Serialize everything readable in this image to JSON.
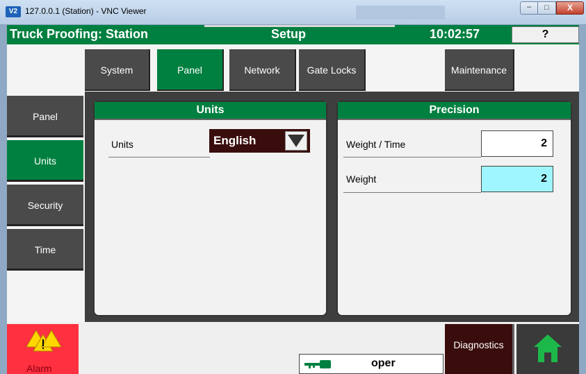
{
  "window": {
    "title": "127.0.0.1 (Station) - VNC Viewer",
    "icon_text": "V2",
    "controls": {
      "minimize": "–",
      "maximize": "□",
      "close": "X"
    }
  },
  "header": {
    "title": "Truck Proofing: Station",
    "screen": "Setup",
    "time": "10:02:57",
    "help_label": "?"
  },
  "top_tabs": [
    {
      "label": "System",
      "active": false
    },
    {
      "label": "Panel",
      "active": true
    },
    {
      "label": "Network",
      "active": false
    },
    {
      "label": "Gate Locks",
      "active": false
    },
    {
      "label": "Maintenance",
      "active": false
    }
  ],
  "side_tabs": [
    {
      "label": "Panel",
      "active": false
    },
    {
      "label": "Units",
      "active": true
    },
    {
      "label": "Security",
      "active": false
    },
    {
      "label": "Time",
      "active": false
    }
  ],
  "units_panel": {
    "title": "Units",
    "row_label": "Units",
    "selected_value": "English"
  },
  "precision_panel": {
    "title": "Precision",
    "rows": [
      {
        "label": "Weight / Time",
        "value": "2"
      },
      {
        "label": "Weight",
        "value": "2"
      }
    ]
  },
  "footer": {
    "alarm_label": "Alarm",
    "user": "oper",
    "diagnostics_label": "Diagnostics"
  },
  "colors": {
    "brand_green": "#008040",
    "dark_tab": "#4a4a4a",
    "maroon": "#3a0d0d",
    "alarm_red": "#ff3040",
    "focus_cyan": "#9ff6ff"
  }
}
